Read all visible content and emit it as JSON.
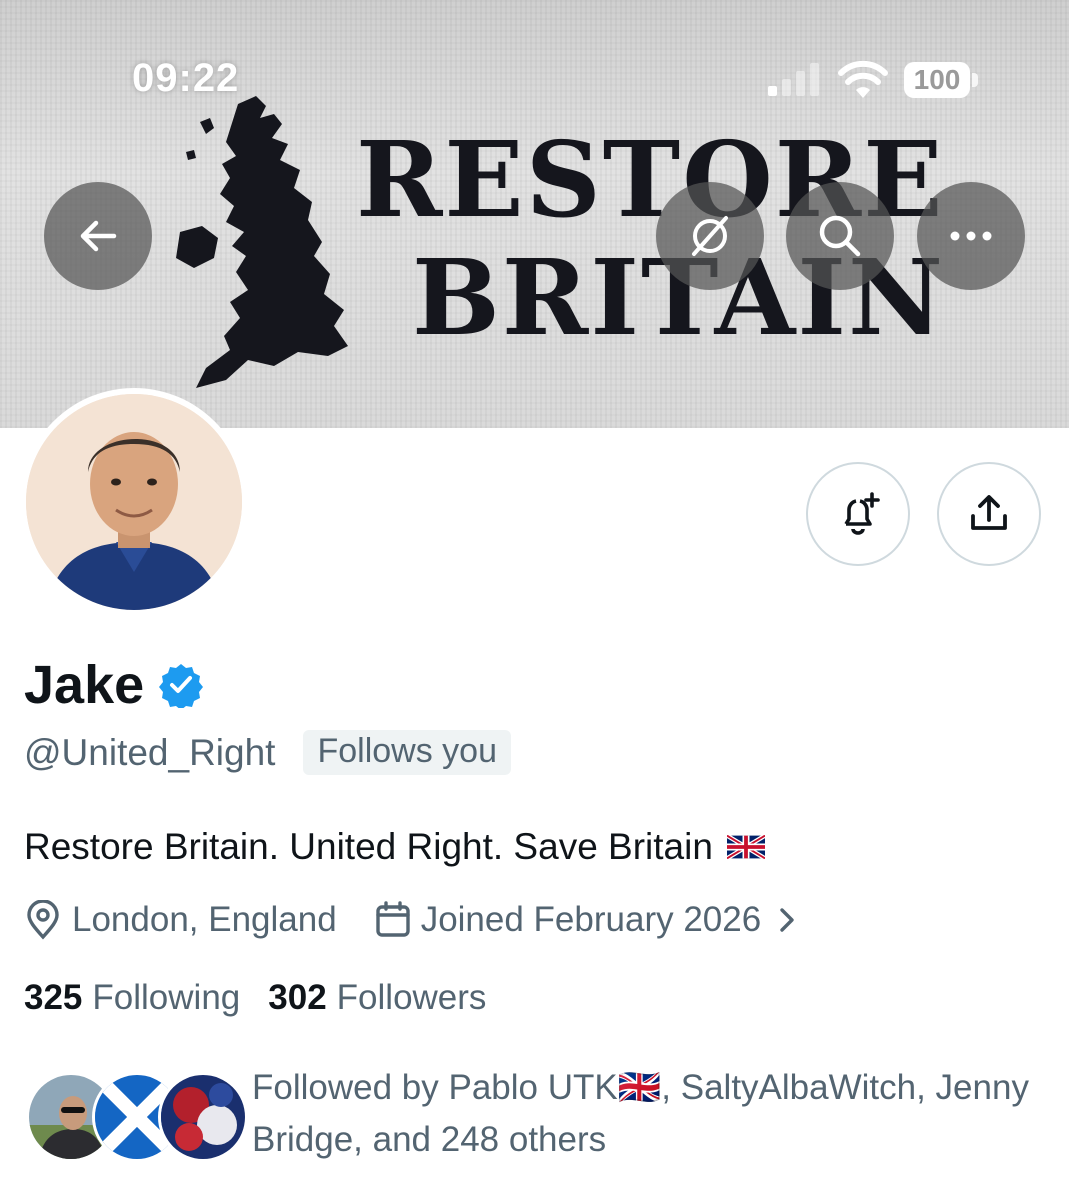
{
  "status_bar": {
    "time": "09:22",
    "battery": "100"
  },
  "banner": {
    "line1": "RESTORE",
    "line2": "BRITAIN"
  },
  "header_icons": {
    "back": "arrow-left-icon",
    "translate": "globe-slash-icon",
    "search": "search-icon",
    "more": "more-icon"
  },
  "profile": {
    "name": "Jake",
    "handle": "@United_Right",
    "follows_you": "Follows you",
    "bio": "Restore Britain. United Right. Save Britain",
    "location": "London, England",
    "joined": "Joined February 2026",
    "following_count": "325",
    "following_label": "Following",
    "followers_count": "302",
    "followers_label": "Followers",
    "followed_by": "Followed by Pablo UTK🇬🇧, SaltyAlbaWitch, Jenny Bridge, and 248 others"
  },
  "colors": {
    "verified": "#1d9bf0",
    "secondary_text": "#536471",
    "primary_text": "#0f1419"
  }
}
